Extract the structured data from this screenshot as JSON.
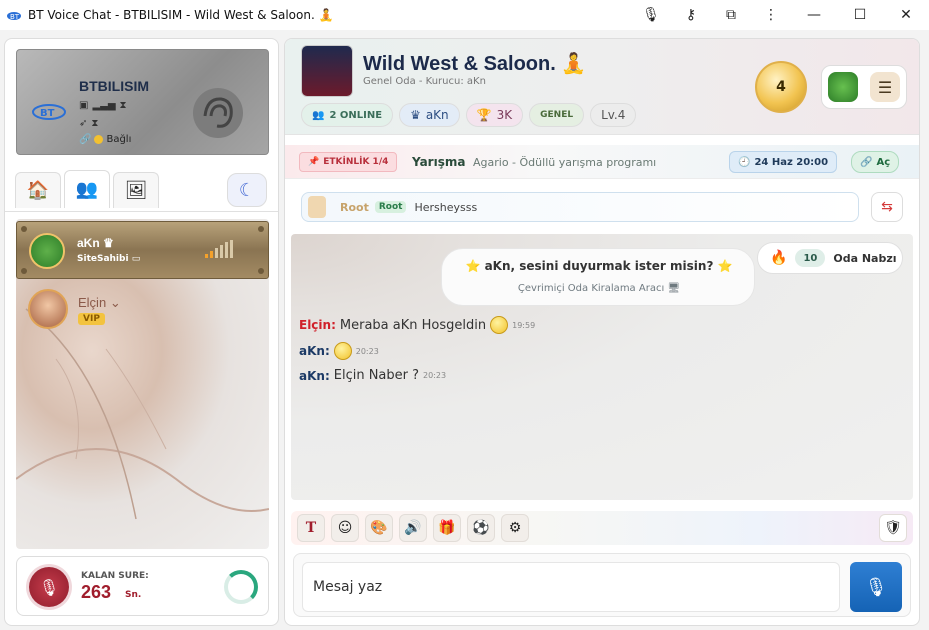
{
  "window": {
    "title": "BT Voice Chat - BTBILISIM - Wild West & Saloon. 🧘",
    "controls": [
      "microphone-icon",
      "key-icon",
      "extension-icon",
      "more-icon",
      "minimize-icon",
      "maximize-icon",
      "close-icon"
    ],
    "control_glyphs": {
      "mic": "🎙",
      "key": "⚷",
      "ext": "⧉",
      "more": "⋮",
      "min": "—",
      "max": "☐",
      "close": "✕"
    }
  },
  "profile": {
    "username": "BTBILISIM",
    "status": "Bağlı",
    "status_color": "#f3c130"
  },
  "tabs": [
    {
      "icon": "home-icon",
      "glyph": "🏠"
    },
    {
      "icon": "users-icon",
      "glyph": "👥"
    },
    {
      "icon": "photo-icon",
      "glyph": "🖼"
    }
  ],
  "theme_toggle_glyph": "☾",
  "users": [
    {
      "name": "aKn",
      "crown": "♛",
      "role": "SiteSahibi",
      "signal_on": 2
    },
    {
      "name": "Elçin",
      "badge": "VIP"
    }
  ],
  "timer": {
    "label": "KALAN SURE:",
    "value": "263",
    "unit": "Sn."
  },
  "room": {
    "name": "Wild West & Saloon. 🧘",
    "subtitle": "Genel Oda - Kurucu: aKn",
    "coin_value": "4",
    "menu_glyph": "☰",
    "chips": {
      "online": "2  ONLINE",
      "owner": "aKn",
      "trophy": "3K",
      "category": "GENEL",
      "level": "Lv.4"
    }
  },
  "event": {
    "badge": "ETKİNLİK 1/4",
    "title": "Yarışma",
    "description": "Agario - Ödüllü yarışma programı",
    "date": "24 Haz 20:00",
    "open_label": "Aç"
  },
  "announcement": {
    "name": "Root",
    "tag": "Root",
    "message": "Hersheysss"
  },
  "pulse": {
    "count": "10",
    "label": "Oda Nabzı"
  },
  "invite": {
    "question": "aKn, sesini duyurmak ister misin?",
    "subtitle": "Çevrimiçi Oda Kiralama Aracı"
  },
  "messages": [
    {
      "author": "Elçin:",
      "text": "Meraba aKn Hosgeldin",
      "time": "19:59",
      "color": "#d0202a"
    },
    {
      "author": "aKn:",
      "text": "",
      "time": "20:23",
      "color": "#1c3a66"
    },
    {
      "author": "aKn:",
      "text": "Elçin Naber ?",
      "time": "20:23",
      "color": "#1c3a66"
    }
  ],
  "toolbar": [
    {
      "name": "text-format-icon",
      "glyph": "T"
    },
    {
      "name": "emoji-icon",
      "glyph": "☺"
    },
    {
      "name": "palette-icon",
      "glyph": "🎨"
    },
    {
      "name": "speaker-icon",
      "glyph": "🔊"
    },
    {
      "name": "gift-icon",
      "glyph": "🎁"
    },
    {
      "name": "ball-icon",
      "glyph": "⚽"
    },
    {
      "name": "settings-icon",
      "glyph": "⚙"
    }
  ],
  "shield_glyph": "🛡",
  "input": {
    "placeholder": "Mesaj yaz"
  }
}
